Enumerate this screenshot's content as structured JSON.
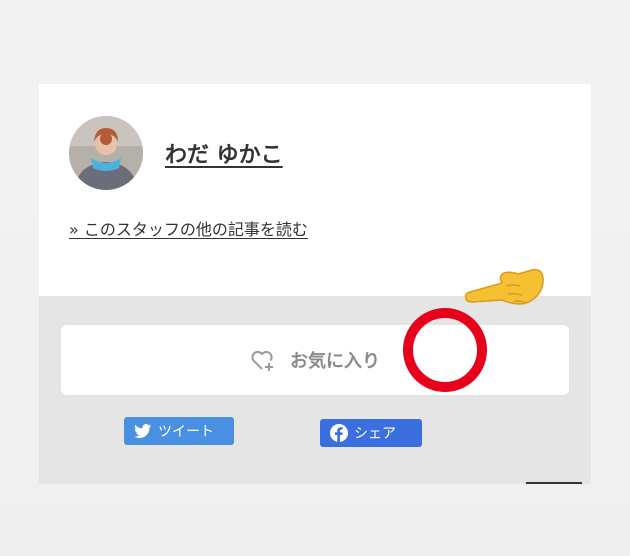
{
  "author": {
    "name": "わだ ゆかこ",
    "more_link": "» このスタッフの他の記事を読む"
  },
  "favorite": {
    "label": "お気に入り",
    "icon": "heart-plus-icon"
  },
  "share": {
    "tweet_label": "ツイート",
    "facebook_label": "シェア",
    "twitter_color": "#4a90e2",
    "facebook_color": "#3b6fe0"
  },
  "annotation": {
    "circle_color": "#e60019",
    "hand_icon": "pointing-hand-emoji"
  }
}
